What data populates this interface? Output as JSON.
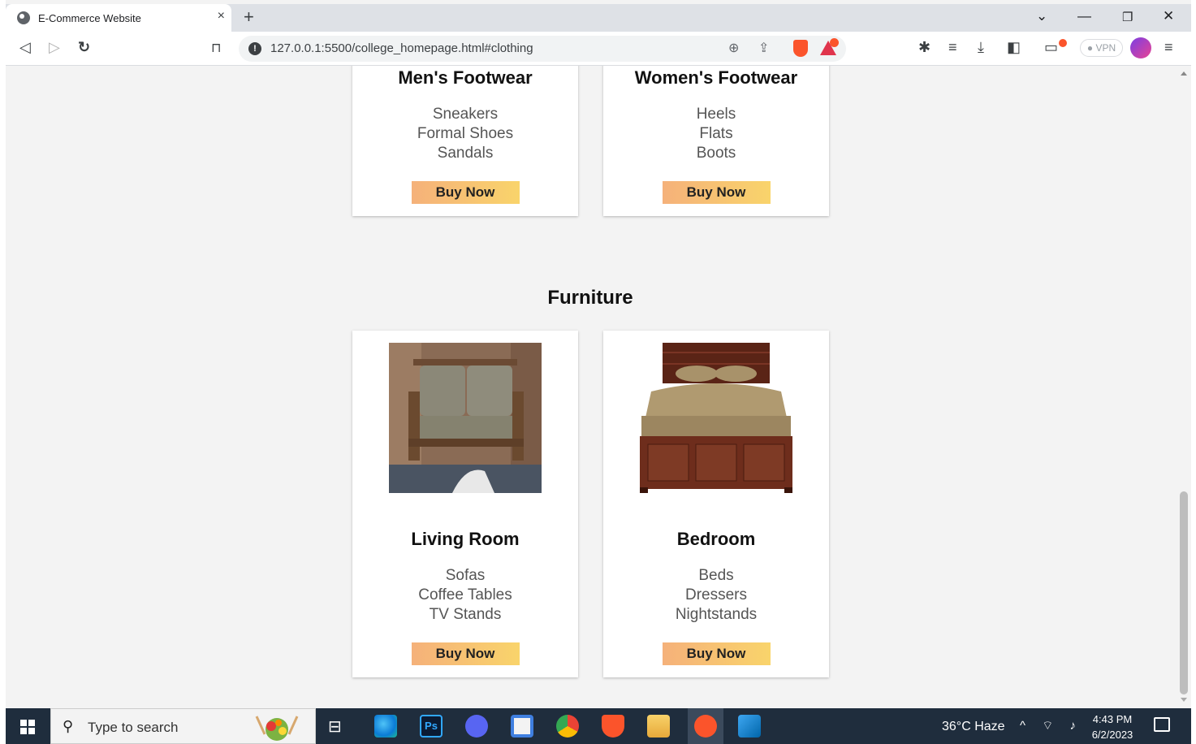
{
  "browser": {
    "tab_title": "E-Commerce Website",
    "tab_close": "×",
    "new_tab": "+",
    "url": "127.0.0.1:5500/college_homepage.html#clothing",
    "vpn_label": "● VPN"
  },
  "page": {
    "footwear_cards": [
      {
        "title": "Men's Footwear",
        "items": [
          "Sneakers",
          "Formal Shoes",
          "Sandals"
        ],
        "button": "Buy Now"
      },
      {
        "title": "Women's Footwear",
        "items": [
          "Heels",
          "Flats",
          "Boots"
        ],
        "button": "Buy Now"
      }
    ],
    "furniture": {
      "section_title": "Furniture",
      "cards": [
        {
          "title": "Living Room",
          "items": [
            "Sofas",
            "Coffee Tables",
            "TV Stands"
          ],
          "button": "Buy Now",
          "image": "sofa"
        },
        {
          "title": "Bedroom",
          "items": [
            "Beds",
            "Dressers",
            "Nightstands"
          ],
          "button": "Buy Now",
          "image": "bed"
        }
      ]
    }
  },
  "taskbar": {
    "search_placeholder": "Type to search",
    "weather": "36°C  Haze",
    "time": "4:43 PM",
    "date": "6/2/2023"
  },
  "colors": {
    "button_gradient_start": "#f5b17a",
    "button_gradient_end": "#f9d46b",
    "page_background": "#f3f3f3",
    "taskbar": "#1f2d3d"
  }
}
